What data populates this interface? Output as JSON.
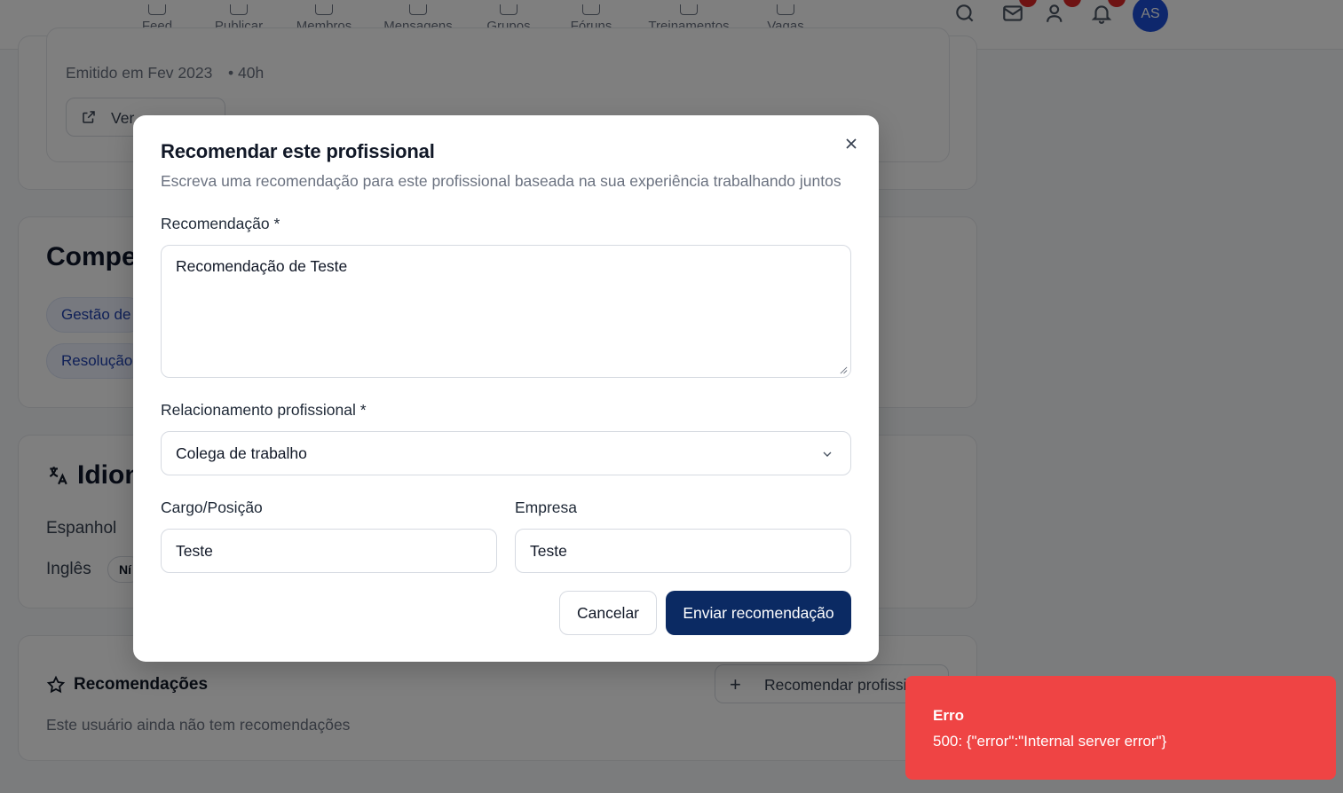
{
  "nav": {
    "items": [
      {
        "label": "Feed",
        "icon": "home-icon"
      },
      {
        "label": "Publicar",
        "icon": "pen-icon"
      },
      {
        "label": "Membros",
        "icon": "users-icon"
      },
      {
        "label": "Mensagens",
        "icon": "mail-icon"
      },
      {
        "label": "Grupos",
        "icon": "chat-icon"
      },
      {
        "label": "Fóruns",
        "icon": "book-icon"
      },
      {
        "label": "Treinamentos",
        "icon": "graduation-icon"
      },
      {
        "label": "Vagas",
        "icon": "briefcase-icon"
      }
    ],
    "avatar_initials": "AS"
  },
  "background": {
    "certificate": {
      "issued": "Emitido em Fev 2023",
      "hours": "• 40h",
      "view_button": "Ver"
    },
    "skills": {
      "title": "Compet",
      "chips": [
        "Gestão de",
        "Resolução"
      ]
    },
    "languages": {
      "title": "Idion",
      "items": [
        "Espanhol",
        "Inglês"
      ],
      "level_badge": "Ní"
    },
    "recommendations": {
      "title": "Recomendações",
      "empty": "Este usuário ainda não tem recomendações",
      "recommend_button": "Recomendar profissi"
    }
  },
  "modal": {
    "title": "Recomendar este profissional",
    "subtitle": "Escreva uma recomendação para este profissional baseada na sua experiência trabalhando juntos",
    "recommendation_label": "Recomendação *",
    "recommendation_value": "Recomendação de Teste",
    "relationship_label": "Relacionamento profissional *",
    "relationship_value": "Colega de trabalho",
    "position_label": "Cargo/Posição",
    "position_value": "Teste",
    "company_label": "Empresa",
    "company_value": "Teste",
    "cancel_label": "Cancelar",
    "submit_label": "Enviar recomendação"
  },
  "toast": {
    "title": "Erro",
    "message": "500: {\"error\":\"Internal server error\"}"
  },
  "colors": {
    "primary": "#0b2a63",
    "error": "#ef4444",
    "avatar": "#1d4ed8",
    "badge": "#dc2626"
  }
}
